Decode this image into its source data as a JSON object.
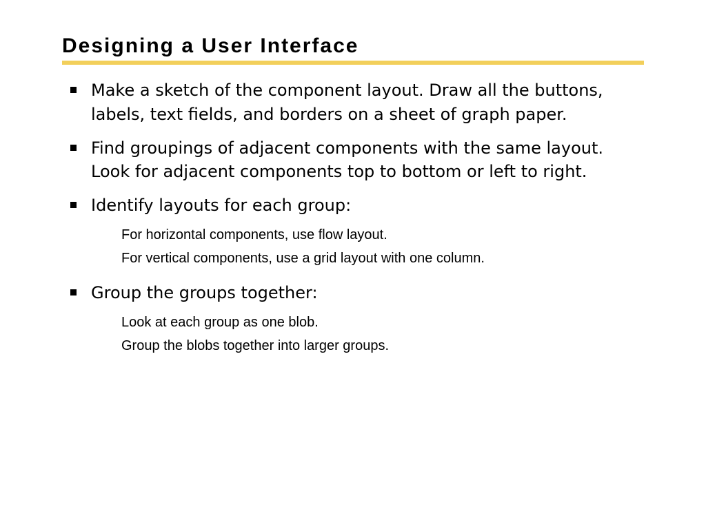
{
  "title": "Designing a User Interface",
  "colors": {
    "accent": "#f2cf5b"
  },
  "bullets": [
    {
      "text": "Make a sketch of the component layout. Draw all the buttons, labels, text fields, and borders on a sheet of graph paper.",
      "sub": []
    },
    {
      "text": "Find groupings of adjacent components with the same layout. Look for adjacent components top to bottom or left to  right.",
      "sub": []
    },
    {
      "text": "Identify layouts for each group:",
      "sub": [
        "For horizontal components, use flow layout.",
        "For vertical components, use a grid layout with one column."
      ]
    },
    {
      "text": "Group the groups together:",
      "sub": [
        "Look at each group as one blob.",
        "Group the blobs together into larger groups."
      ]
    }
  ]
}
